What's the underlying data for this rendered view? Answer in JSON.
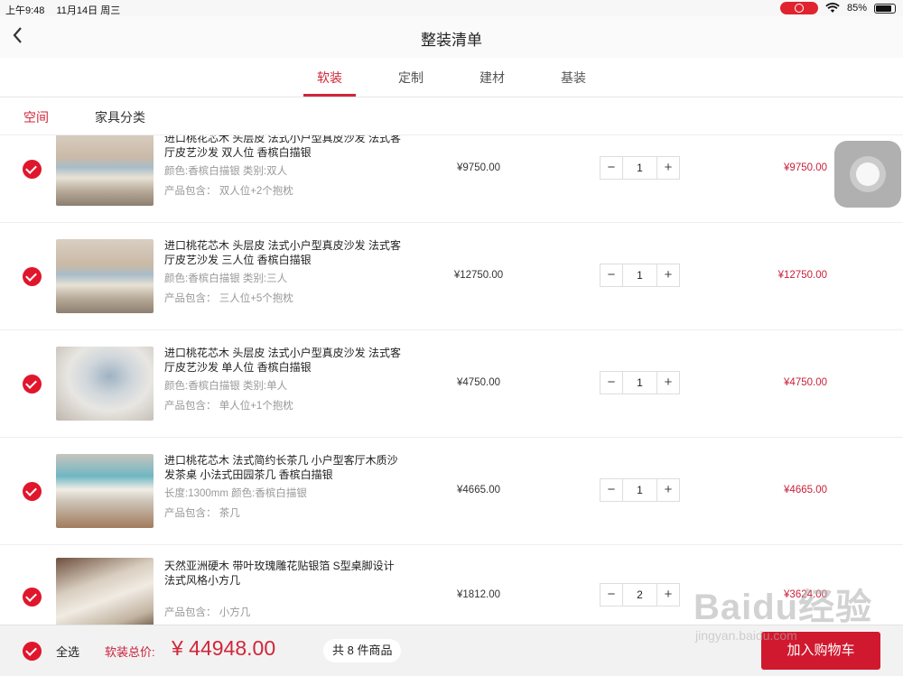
{
  "status_bar": {
    "time": "上午9:48",
    "date": "11月14日 周三",
    "battery": "85%",
    "battery_level": 0.85
  },
  "nav": {
    "title": "整装清单",
    "back_icon": "chevron-left-icon"
  },
  "tabs": [
    {
      "label": "软装",
      "active": true
    },
    {
      "label": "定制",
      "active": false
    },
    {
      "label": "建材",
      "active": false
    },
    {
      "label": "基装",
      "active": false
    }
  ],
  "filters": [
    {
      "label": "空间",
      "active": true
    },
    {
      "label": "家具分类",
      "active": false
    }
  ],
  "items": [
    {
      "name": "进口桃花芯木 头层皮 法式小户型真皮沙发 法式客厅皮艺沙发 双人位 香槟白描银",
      "attr1": "颜色:香槟白描银 类别:双人",
      "attr2": "产品包含：  双人位+2个抱枕",
      "price": "¥9750.00",
      "qty": "1",
      "subtotal": "¥9750.00",
      "checked": true
    },
    {
      "name": "进口桃花芯木 头层皮 法式小户型真皮沙发 法式客厅皮艺沙发 三人位 香槟白描银",
      "attr1": "颜色:香槟白描银 类别:三人",
      "attr2": "产品包含：  三人位+5个抱枕",
      "price": "¥12750.00",
      "qty": "1",
      "subtotal": "¥12750.00",
      "checked": true
    },
    {
      "name": "进口桃花芯木 头层皮 法式小户型真皮沙发 法式客厅皮艺沙发 单人位 香槟白描银",
      "attr1": "颜色:香槟白描银 类别:单人",
      "attr2": "产品包含：  单人位+1个抱枕",
      "price": "¥4750.00",
      "qty": "1",
      "subtotal": "¥4750.00",
      "checked": true
    },
    {
      "name": "进口桃花芯木 法式简约长茶几 小户型客厅木质沙发茶桌 小法式田园茶几 香槟白描银",
      "attr1": "长度:1300mm 颜色:香槟白描银",
      "attr2": "产品包含：  茶几",
      "price": "¥4665.00",
      "qty": "1",
      "subtotal": "¥4665.00",
      "checked": true
    },
    {
      "name": "天然亚洲硬木 带叶玫瑰雕花贴银箔 S型桌脚设计 法式风格小方几",
      "attr1": "",
      "attr2": "产品包含：  小方几",
      "price": "¥1812.00",
      "qty": "2",
      "subtotal": "¥3624.00",
      "checked": true
    }
  ],
  "footer": {
    "select_all": "全选",
    "total_label": "软装总价:",
    "total": "¥ 44948.00",
    "count": "共 8 件商品",
    "add_to_cart": "加入购物车"
  },
  "watermark": {
    "logo": "Baidu经验",
    "url": "jingyan.baidu.com"
  }
}
